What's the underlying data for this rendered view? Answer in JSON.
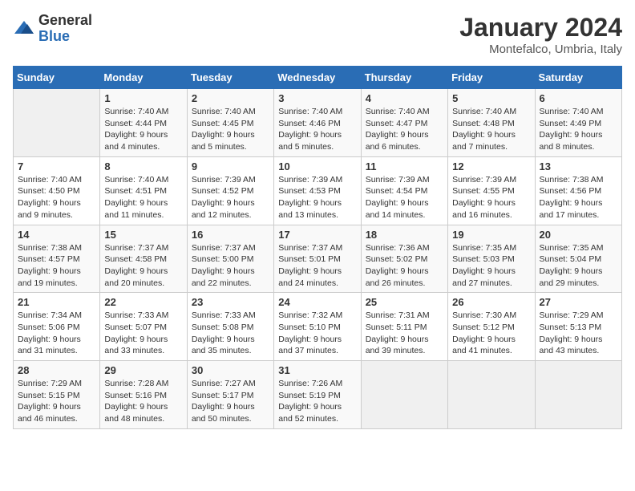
{
  "logo": {
    "general": "General",
    "blue": "Blue"
  },
  "title": "January 2024",
  "location": "Montefalco, Umbria, Italy",
  "days_of_week": [
    "Sunday",
    "Monday",
    "Tuesday",
    "Wednesday",
    "Thursday",
    "Friday",
    "Saturday"
  ],
  "weeks": [
    [
      {
        "day": "",
        "empty": true
      },
      {
        "day": "1",
        "sunrise": "7:40 AM",
        "sunset": "4:44 PM",
        "daylight": "9 hours and 4 minutes."
      },
      {
        "day": "2",
        "sunrise": "7:40 AM",
        "sunset": "4:45 PM",
        "daylight": "9 hours and 5 minutes."
      },
      {
        "day": "3",
        "sunrise": "7:40 AM",
        "sunset": "4:46 PM",
        "daylight": "9 hours and 5 minutes."
      },
      {
        "day": "4",
        "sunrise": "7:40 AM",
        "sunset": "4:47 PM",
        "daylight": "9 hours and 6 minutes."
      },
      {
        "day": "5",
        "sunrise": "7:40 AM",
        "sunset": "4:48 PM",
        "daylight": "9 hours and 7 minutes."
      },
      {
        "day": "6",
        "sunrise": "7:40 AM",
        "sunset": "4:49 PM",
        "daylight": "9 hours and 8 minutes."
      }
    ],
    [
      {
        "day": "7",
        "sunrise": "7:40 AM",
        "sunset": "4:50 PM",
        "daylight": "9 hours and 9 minutes."
      },
      {
        "day": "8",
        "sunrise": "7:40 AM",
        "sunset": "4:51 PM",
        "daylight": "9 hours and 11 minutes."
      },
      {
        "day": "9",
        "sunrise": "7:39 AM",
        "sunset": "4:52 PM",
        "daylight": "9 hours and 12 minutes."
      },
      {
        "day": "10",
        "sunrise": "7:39 AM",
        "sunset": "4:53 PM",
        "daylight": "9 hours and 13 minutes."
      },
      {
        "day": "11",
        "sunrise": "7:39 AM",
        "sunset": "4:54 PM",
        "daylight": "9 hours and 14 minutes."
      },
      {
        "day": "12",
        "sunrise": "7:39 AM",
        "sunset": "4:55 PM",
        "daylight": "9 hours and 16 minutes."
      },
      {
        "day": "13",
        "sunrise": "7:38 AM",
        "sunset": "4:56 PM",
        "daylight": "9 hours and 17 minutes."
      }
    ],
    [
      {
        "day": "14",
        "sunrise": "7:38 AM",
        "sunset": "4:57 PM",
        "daylight": "9 hours and 19 minutes."
      },
      {
        "day": "15",
        "sunrise": "7:37 AM",
        "sunset": "4:58 PM",
        "daylight": "9 hours and 20 minutes."
      },
      {
        "day": "16",
        "sunrise": "7:37 AM",
        "sunset": "5:00 PM",
        "daylight": "9 hours and 22 minutes."
      },
      {
        "day": "17",
        "sunrise": "7:37 AM",
        "sunset": "5:01 PM",
        "daylight": "9 hours and 24 minutes."
      },
      {
        "day": "18",
        "sunrise": "7:36 AM",
        "sunset": "5:02 PM",
        "daylight": "9 hours and 26 minutes."
      },
      {
        "day": "19",
        "sunrise": "7:35 AM",
        "sunset": "5:03 PM",
        "daylight": "9 hours and 27 minutes."
      },
      {
        "day": "20",
        "sunrise": "7:35 AM",
        "sunset": "5:04 PM",
        "daylight": "9 hours and 29 minutes."
      }
    ],
    [
      {
        "day": "21",
        "sunrise": "7:34 AM",
        "sunset": "5:06 PM",
        "daylight": "9 hours and 31 minutes."
      },
      {
        "day": "22",
        "sunrise": "7:33 AM",
        "sunset": "5:07 PM",
        "daylight": "9 hours and 33 minutes."
      },
      {
        "day": "23",
        "sunrise": "7:33 AM",
        "sunset": "5:08 PM",
        "daylight": "9 hours and 35 minutes."
      },
      {
        "day": "24",
        "sunrise": "7:32 AM",
        "sunset": "5:10 PM",
        "daylight": "9 hours and 37 minutes."
      },
      {
        "day": "25",
        "sunrise": "7:31 AM",
        "sunset": "5:11 PM",
        "daylight": "9 hours and 39 minutes."
      },
      {
        "day": "26",
        "sunrise": "7:30 AM",
        "sunset": "5:12 PM",
        "daylight": "9 hours and 41 minutes."
      },
      {
        "day": "27",
        "sunrise": "7:29 AM",
        "sunset": "5:13 PM",
        "daylight": "9 hours and 43 minutes."
      }
    ],
    [
      {
        "day": "28",
        "sunrise": "7:29 AM",
        "sunset": "5:15 PM",
        "daylight": "9 hours and 46 minutes."
      },
      {
        "day": "29",
        "sunrise": "7:28 AM",
        "sunset": "5:16 PM",
        "daylight": "9 hours and 48 minutes."
      },
      {
        "day": "30",
        "sunrise": "7:27 AM",
        "sunset": "5:17 PM",
        "daylight": "9 hours and 50 minutes."
      },
      {
        "day": "31",
        "sunrise": "7:26 AM",
        "sunset": "5:19 PM",
        "daylight": "9 hours and 52 minutes."
      },
      {
        "day": "",
        "empty": true
      },
      {
        "day": "",
        "empty": true
      },
      {
        "day": "",
        "empty": true
      }
    ]
  ]
}
